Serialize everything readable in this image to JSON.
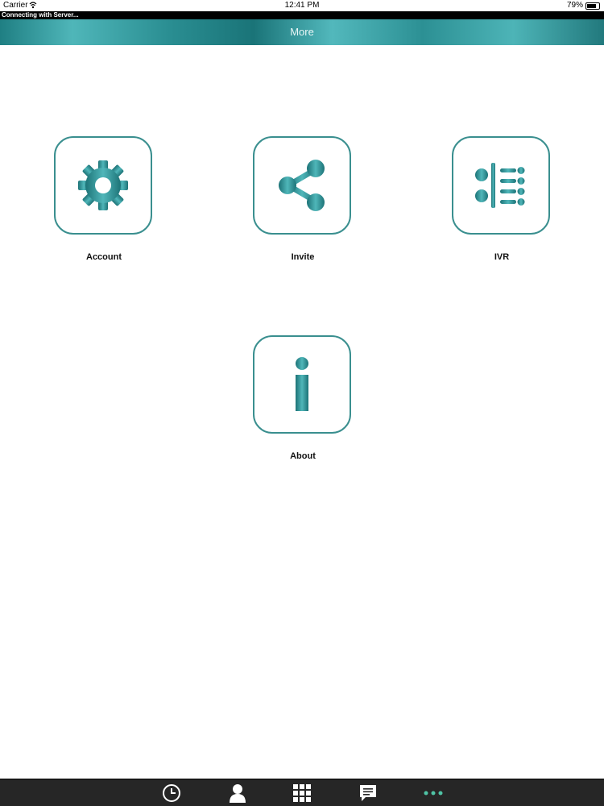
{
  "status_bar": {
    "carrier": "Carrier",
    "time": "12:41 PM",
    "battery": "79%",
    "battery_level": 0.79
  },
  "connection_banner": "Connecting with Server...",
  "nav": {
    "title": "More"
  },
  "tiles": [
    {
      "label": "Account",
      "icon": "gear-icon"
    },
    {
      "label": "Invite",
      "icon": "share-icon"
    },
    {
      "label": "IVR",
      "icon": "ivr-menu-icon"
    },
    {
      "label": "About",
      "icon": "info-icon"
    }
  ],
  "tab_bar": {
    "items": [
      {
        "icon": "clock-icon"
      },
      {
        "icon": "contact-icon"
      },
      {
        "icon": "keypad-icon"
      },
      {
        "icon": "chat-icon"
      },
      {
        "icon": "more-dots-icon",
        "active": true
      }
    ]
  },
  "colors": {
    "accent": "#3a9ea0",
    "tile_border": "#3a8f8f",
    "tab_bar_bg": "#262626",
    "tab_active": "#4fc3a5"
  }
}
